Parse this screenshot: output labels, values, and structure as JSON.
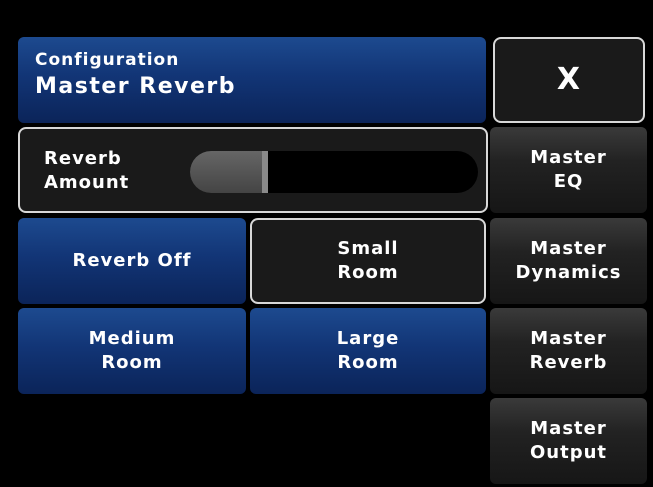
{
  "header": {
    "section": "Configuration",
    "title": "Master Reverb"
  },
  "close_label": "X",
  "reverb_amount": {
    "label_line1": "Reverb",
    "label_line2": "Amount",
    "value_fraction": 0.27
  },
  "presets": [
    {
      "line1": "Reverb Off",
      "line2": ""
    },
    {
      "line1": "Small",
      "line2": "Room",
      "selected": true
    },
    {
      "line1": "Medium",
      "line2": "Room"
    },
    {
      "line1": "Large",
      "line2": "Room"
    }
  ],
  "nav": [
    {
      "line1": "Master",
      "line2": "EQ"
    },
    {
      "line1": "Master",
      "line2": "Dynamics"
    },
    {
      "line1": "Master",
      "line2": "Reverb"
    },
    {
      "line1": "Master",
      "line2": "Output"
    }
  ],
  "colors": {
    "accent_blue": "#123576",
    "button_dark": "#222222",
    "outline": "#d8d8d8",
    "background": "#000000"
  }
}
